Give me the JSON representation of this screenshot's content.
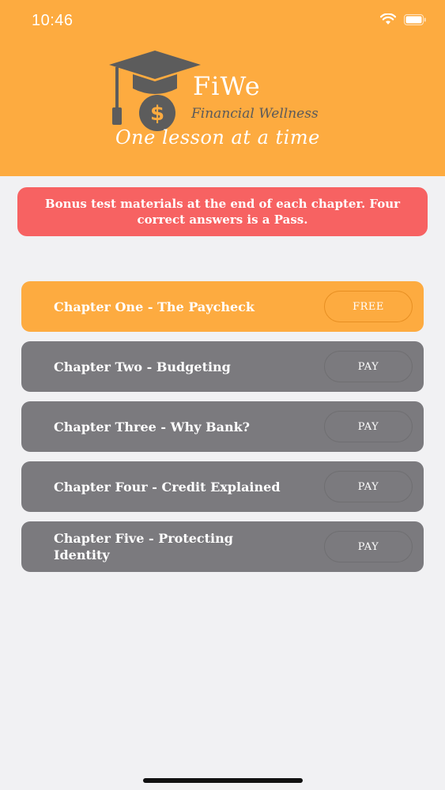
{
  "status_bar": {
    "time": "10:46"
  },
  "header": {
    "brand": "FiWe",
    "subtitle": "Financial Wellness",
    "tagline": "One lesson at a time",
    "logo_symbol": "$"
  },
  "banner": {
    "text": "Bonus test materials at the end of each chapter. Four correct answers is a Pass."
  },
  "chapters": [
    {
      "title": "Chapter One - The Paycheck",
      "button": "FREE"
    },
    {
      "title": "Chapter Two - Budgeting",
      "button": "PAY"
    },
    {
      "title": "Chapter Three - Why Bank?",
      "button": "PAY"
    },
    {
      "title": "Chapter Four - Credit Explained",
      "button": "PAY"
    },
    {
      "title": "Chapter Five - Protecting Identity",
      "button": "PAY"
    }
  ],
  "colors": {
    "header": "#fdab40",
    "banner": "#f76262",
    "locked_chapter": "#7b7a7e",
    "background": "#f1f1f3"
  },
  "icons": [
    "wifi-icon",
    "battery-icon",
    "graduation-cap-icon",
    "coin-icon"
  ]
}
